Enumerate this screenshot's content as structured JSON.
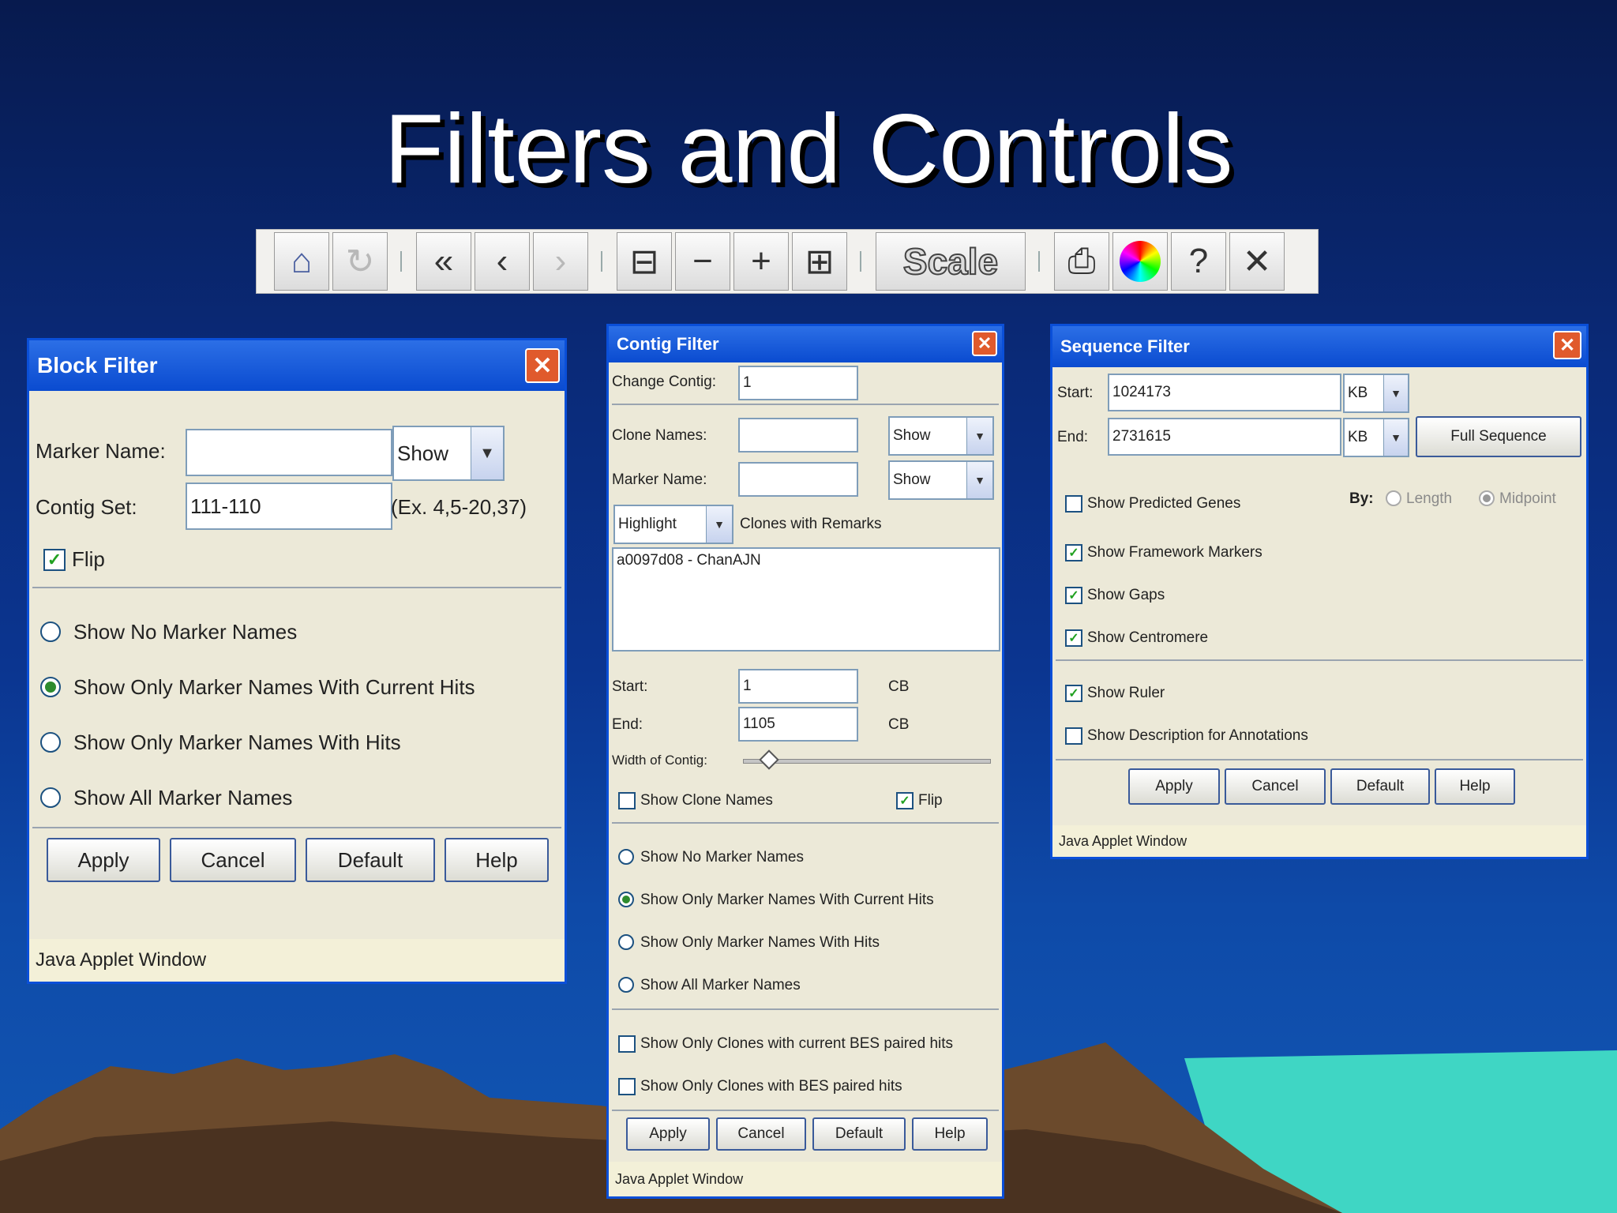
{
  "slide": {
    "title": "Filters and Controls"
  },
  "toolbar": {
    "buttons": [
      {
        "icon": "home-icon",
        "glyph": "⌂"
      },
      {
        "icon": "refresh-icon",
        "glyph": "↻"
      },
      {
        "icon": "jump-back-icon",
        "glyph": "«"
      },
      {
        "icon": "back-icon",
        "glyph": "‹"
      },
      {
        "icon": "forward-icon",
        "glyph": "›"
      },
      {
        "icon": "shrink-icon",
        "glyph": "⊟"
      },
      {
        "icon": "zoom-out-icon",
        "glyph": "−"
      },
      {
        "icon": "zoom-in-icon",
        "glyph": "+"
      },
      {
        "icon": "expand-icon",
        "glyph": "⊞"
      },
      {
        "icon": "print-icon",
        "glyph": "⎙"
      },
      {
        "icon": "color-wheel-icon",
        "glyph": "●"
      },
      {
        "icon": "help-icon",
        "glyph": "?"
      },
      {
        "icon": "close-icon",
        "glyph": "✕"
      }
    ],
    "scale_label": "Scale"
  },
  "block_filter": {
    "title": "Block Filter",
    "marker_name_label": "Marker Name:",
    "marker_name_value": "",
    "marker_show_option": "Show",
    "contig_set_label": "Contig Set:",
    "contig_set_value": "111-110",
    "contig_set_hint": "(Ex. 4,5-20,37)",
    "flip_label": "Flip",
    "flip_checked": true,
    "radios": [
      {
        "label": "Show No Marker Names",
        "selected": false
      },
      {
        "label": "Show Only Marker Names With Current Hits",
        "selected": true
      },
      {
        "label": "Show Only Marker Names With Hits",
        "selected": false
      },
      {
        "label": "Show All Marker Names",
        "selected": false
      }
    ],
    "buttons": {
      "apply": "Apply",
      "cancel": "Cancel",
      "default": "Default",
      "help": "Help"
    },
    "status": "Java Applet Window"
  },
  "contig_filter": {
    "title": "Contig Filter",
    "change_contig_label": "Change Contig:",
    "change_contig_value": "1",
    "clone_names_label": "Clone Names:",
    "clone_names_value": "",
    "clone_show_option": "Show",
    "marker_name_label": "Marker Name:",
    "marker_name_value": "",
    "marker_show_option": "Show",
    "highlight_option": "Highlight",
    "clones_with_remarks_label": "Clones with Remarks",
    "remarks_text": "a0097d08 - ChanAJN",
    "start_label": "Start:",
    "start_value": "1",
    "start_unit": "CB",
    "end_label": "End:",
    "end_value": "1105",
    "end_unit": "CB",
    "width_label": "Width of Contig:",
    "show_clone_names_label": "Show Clone Names",
    "show_clone_names_checked": false,
    "flip_label": "Flip",
    "flip_checked": true,
    "radios": [
      {
        "label": "Show No Marker Names",
        "selected": false
      },
      {
        "label": "Show Only Marker Names With Current Hits",
        "selected": true
      },
      {
        "label": "Show Only Marker Names With Hits",
        "selected": false
      },
      {
        "label": "Show All Marker Names",
        "selected": false
      }
    ],
    "checks": [
      {
        "label": "Show Only Clones with current BES paired hits",
        "checked": false
      },
      {
        "label": "Show Only Clones with BES paired hits",
        "checked": false
      }
    ],
    "buttons": {
      "apply": "Apply",
      "cancel": "Cancel",
      "default": "Default",
      "help": "Help"
    },
    "status": "Java Applet Window"
  },
  "sequence_filter": {
    "title": "Sequence Filter",
    "start_label": "Start:",
    "start_value": "1024173",
    "start_unit": "KB",
    "end_label": "End:",
    "end_value": "2731615",
    "end_unit": "KB",
    "full_sequence_label": "Full Sequence",
    "show_predicted_genes_label": "Show Predicted Genes",
    "show_predicted_genes_checked": false,
    "by_label": "By:",
    "by_options": [
      {
        "label": "Length",
        "selected": false
      },
      {
        "label": "Midpoint",
        "selected": true
      }
    ],
    "checks": [
      {
        "label": "Show Framework Markers",
        "checked": true
      },
      {
        "label": "Show Gaps",
        "checked": true
      },
      {
        "label": "Show Centromere",
        "checked": true
      }
    ],
    "checks2": [
      {
        "label": "Show Ruler",
        "checked": true
      },
      {
        "label": "Show Description for Annotations",
        "checked": false
      }
    ],
    "buttons": {
      "apply": "Apply",
      "cancel": "Cancel",
      "default": "Default",
      "help": "Help"
    },
    "status": "Java Applet Window"
  }
}
